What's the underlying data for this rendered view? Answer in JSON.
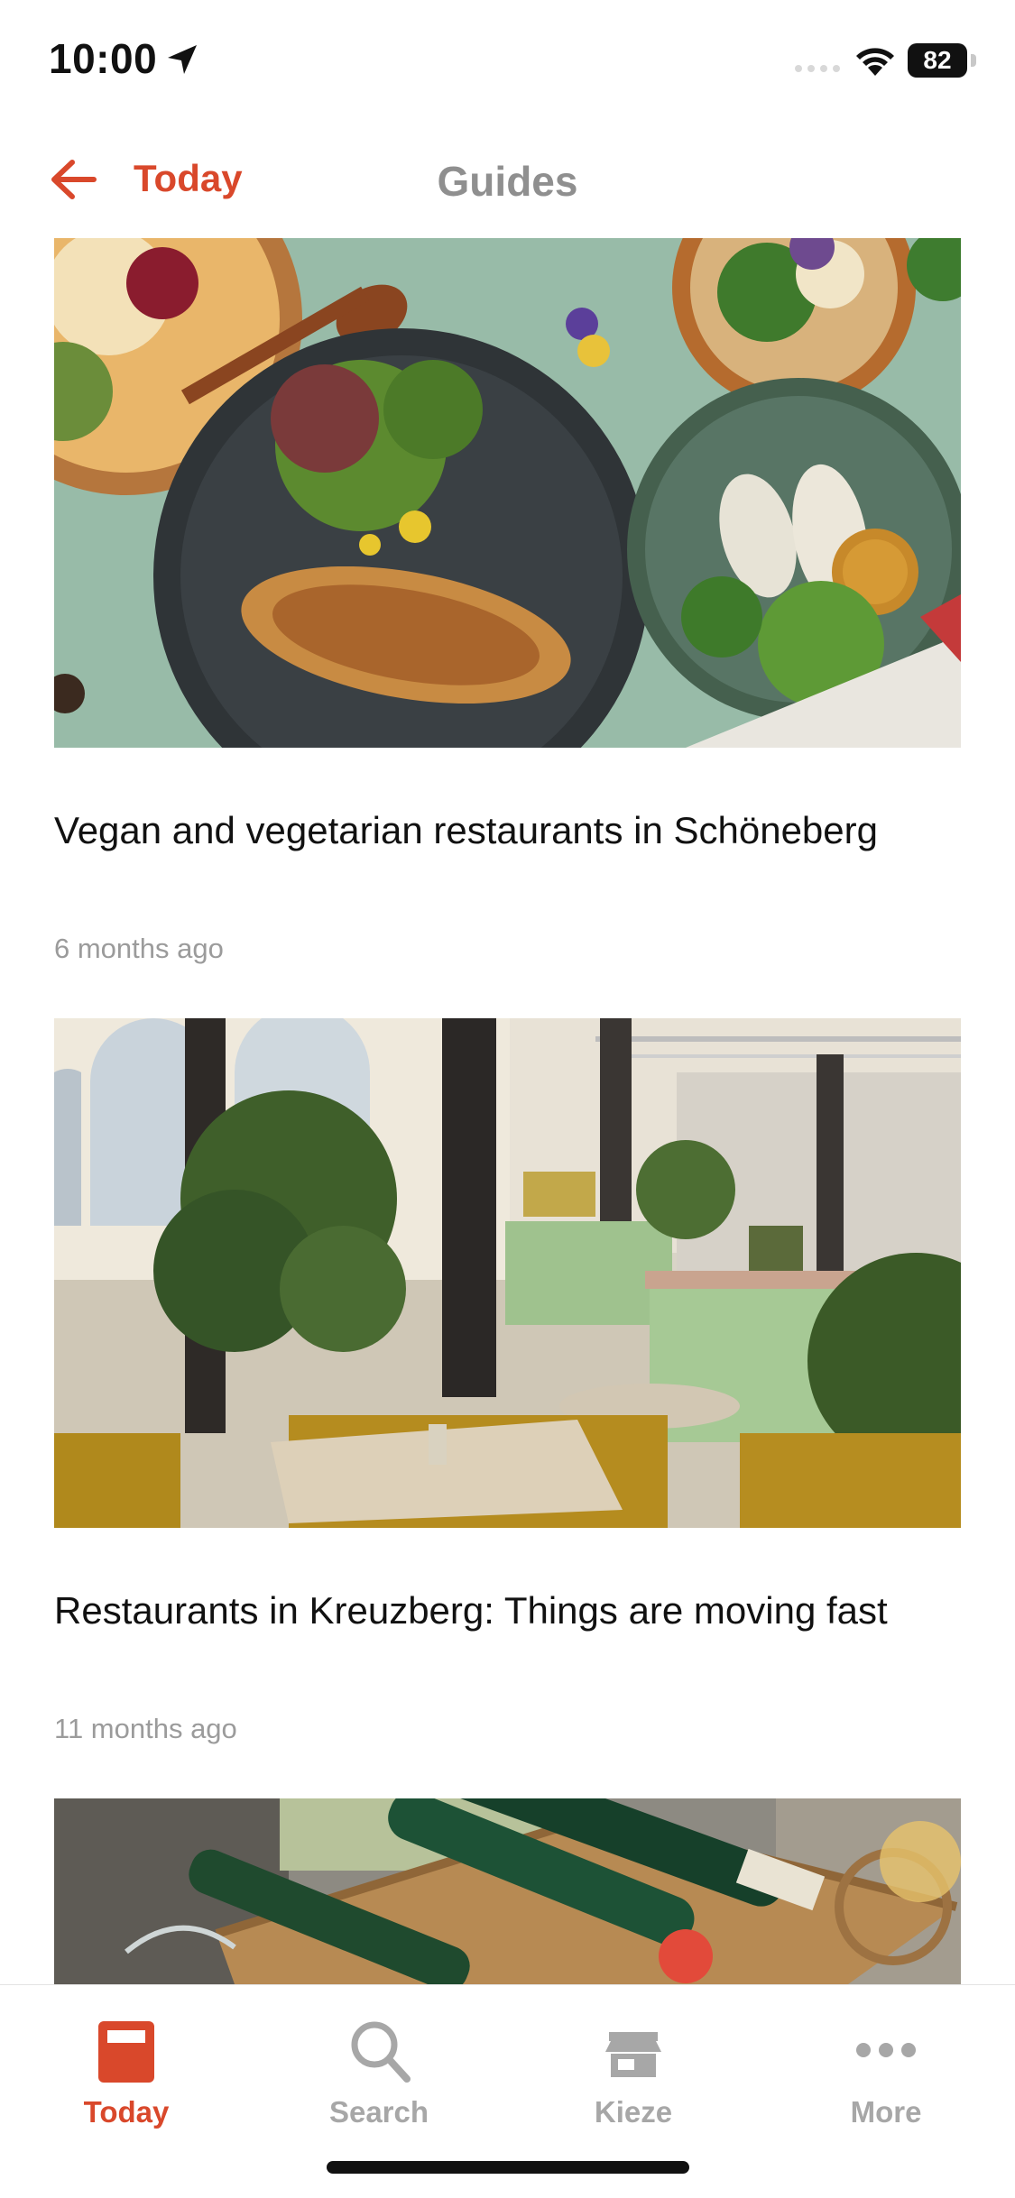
{
  "status_bar": {
    "time": "10:00",
    "battery": "82"
  },
  "nav": {
    "back_label": "Today",
    "title": "Guides"
  },
  "articles": [
    {
      "title": "Vegan and vegetarian restaurants in Schöneberg",
      "age": "6 months ago"
    },
    {
      "title": "Restaurants in Kreuzberg: Things are moving fast",
      "age": "11 months ago"
    },
    {
      "title": "",
      "age": ""
    }
  ],
  "tabs": [
    {
      "label": "Today",
      "icon": "today-icon",
      "active": true
    },
    {
      "label": "Search",
      "icon": "search-icon",
      "active": false
    },
    {
      "label": "Kieze",
      "icon": "shop-icon",
      "active": false
    },
    {
      "label": "More",
      "icon": "more-dots-icon",
      "active": false
    }
  ],
  "colors": {
    "accent": "#d9482b",
    "inactive": "#a7a7a7",
    "muted": "#9b9b9b"
  }
}
